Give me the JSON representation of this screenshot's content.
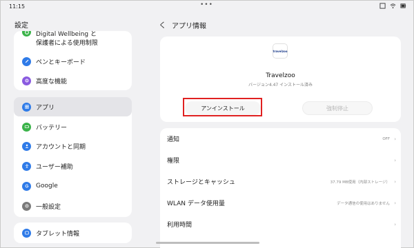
{
  "status": {
    "time": "11:15",
    "dots": "•••"
  },
  "left": {
    "title": "設定",
    "wellbeing_line1": "Digital Wellbeing と",
    "wellbeing_line2": "保護者による使用制限",
    "card1_items": [
      {
        "label": "ペンとキーボード",
        "icon": "pen-icon",
        "color": "#2f7be8"
      },
      {
        "label": "高度な機能",
        "icon": "advanced-icon",
        "color": "#8a5be0"
      }
    ],
    "card2_items": [
      {
        "label": "アプリ",
        "icon": "apps-icon",
        "color": "#2f7be8"
      },
      {
        "label": "バッテリー",
        "icon": "battery-icon",
        "color": "#3bb34a"
      },
      {
        "label": "アカウントと同期",
        "icon": "account-icon",
        "color": "#2f7be8"
      },
      {
        "label": "ユーザー補助",
        "icon": "accessibility-icon",
        "color": "#2f7be8"
      },
      {
        "label": "Google",
        "icon": "google-icon",
        "color": "#2f7be8"
      },
      {
        "label": "一般設定",
        "icon": "general-settings-icon",
        "color": "#7a7a7a"
      }
    ],
    "card3_items": [
      {
        "label": "タブレット情報",
        "icon": "tablet-info-icon",
        "color": "#2f7be8"
      }
    ]
  },
  "right": {
    "back": "く",
    "title": "アプリ情報",
    "app": {
      "icon_text": "travelzoo",
      "name": "Travelzoo",
      "version": "バージョン4.47 インストール済み",
      "uninstall_label": "アンインストール",
      "forcestop_label": "強制停止"
    },
    "rows": [
      {
        "label": "通知",
        "value": "OFF"
      },
      {
        "label": "権限",
        "value": ""
      },
      {
        "label": "ストレージとキャッシュ",
        "value": "37.79 MB使用（内部ストレージ）"
      },
      {
        "label": "WLAN データ使用量",
        "value": "データ通信の使用はありません"
      },
      {
        "label": "利用時間",
        "value": ""
      }
    ]
  },
  "colors": {
    "highlight": "#e02020",
    "accent": "#2f7be8"
  }
}
